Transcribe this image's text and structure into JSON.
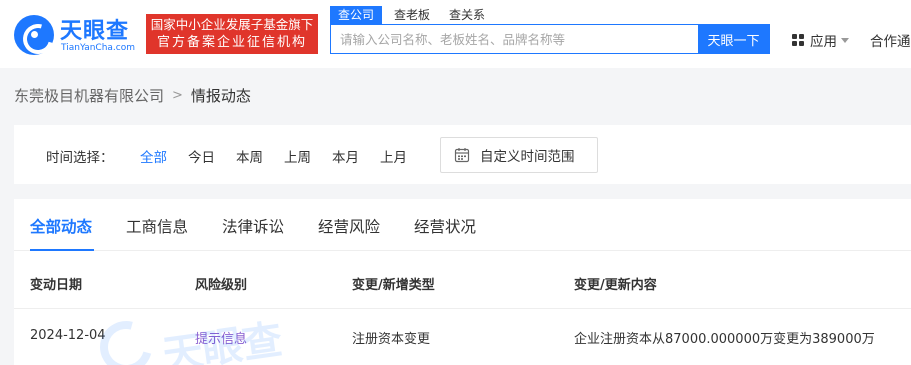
{
  "header": {
    "logo_cn": "天眼查",
    "logo_en": "TianYanCha.com",
    "badge_line1": "国家中小企业发展子基金旗下",
    "badge_line2": "官方备案企业征信机构",
    "search_tabs": [
      "查公司",
      "查老板",
      "查关系"
    ],
    "search_placeholder": "请输入公司名称、老板姓名、品牌名称等",
    "search_button": "天眼一下",
    "apps_label": "应用",
    "coop_label": "合作通"
  },
  "breadcrumb": {
    "company": "东莞极目机器有限公司",
    "current": "情报动态"
  },
  "time_filter": {
    "label": "时间选择：",
    "options": [
      "全部",
      "今日",
      "本周",
      "上周",
      "本月",
      "上月"
    ],
    "active_index": 0,
    "custom_range": "自定义时间范围"
  },
  "tabs": [
    "全部动态",
    "工商信息",
    "法律诉讼",
    "经营风险",
    "经营状况"
  ],
  "table": {
    "headers": [
      "变动日期",
      "风险级别",
      "变更/新增类型",
      "变更/更新内容"
    ],
    "rows": [
      {
        "date": "2024-12-04",
        "risk": "提示信息",
        "type": "注册资本变更",
        "content": "企业注册资本从87000.000000万变更为389000万"
      }
    ]
  },
  "colors": {
    "accent": "#1e78ff",
    "badge_red": "#e0352b",
    "risk_purple": "#8b5fd0",
    "page_bg": "#f4f5f7"
  },
  "icons": {
    "logo": "tianyancha-logo-icon",
    "apps": "grid-icon",
    "apps_caret": "caret-down-icon",
    "calendar": "calendar-icon",
    "breadcrumb_sep": "chevron-right-icon"
  }
}
